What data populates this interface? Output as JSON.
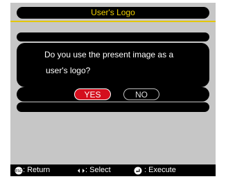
{
  "dialog": {
    "title": "User's Logo",
    "question_line1": "Do you use the present image as a",
    "question_line2": "user's logo?",
    "yes_label": "YES",
    "no_label": "NO"
  },
  "footer": {
    "return_label": ": Return",
    "select_label": ": Select",
    "execute_label": ": Execute",
    "esc_icon_text": "ESC"
  },
  "colors": {
    "background": "#c6c6c6",
    "title_text": "#f0d000",
    "accent_line": "#e3c700",
    "selected_button": "#d40f1e",
    "panel": "#000000"
  },
  "icons": [
    "esc-button-icon",
    "left-right-arrows-icon",
    "enter-button-icon"
  ]
}
